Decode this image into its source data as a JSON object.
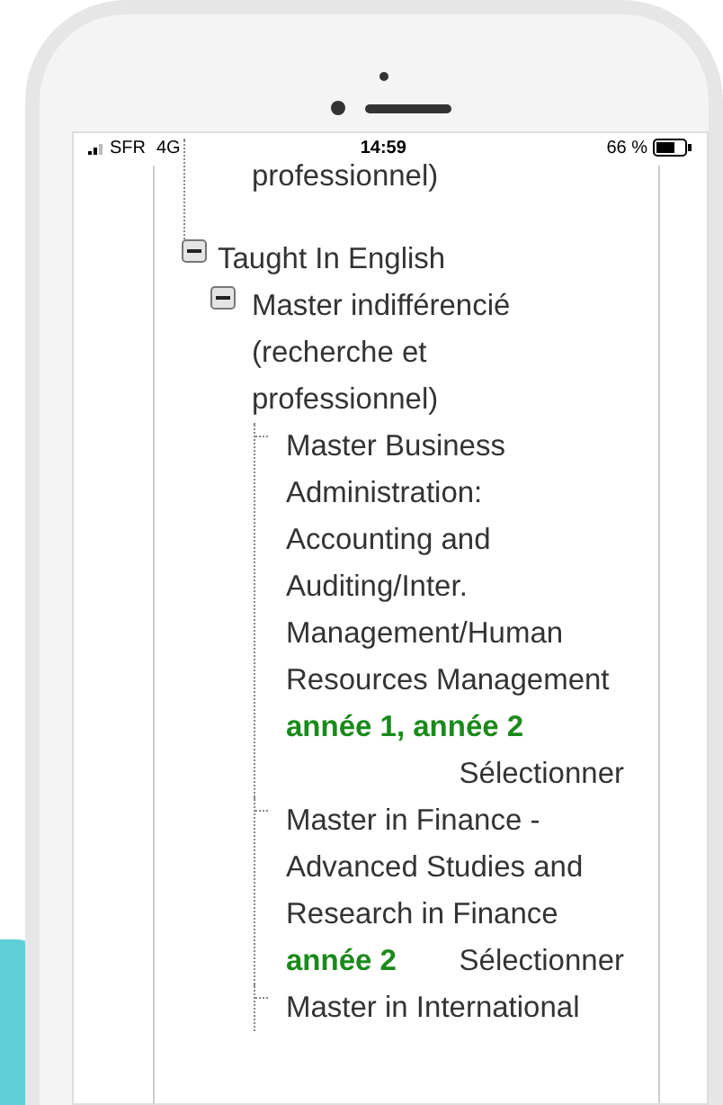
{
  "status_bar": {
    "carrier": "SFR",
    "network": "4G",
    "time": "14:59",
    "battery": "66 %"
  },
  "tree": [
    {
      "label": "professionnel)",
      "kind": "tail"
    },
    {
      "label": "Taught In English",
      "kind": "folder",
      "expanded": true,
      "children": [
        {
          "label": "Master indifférencié (recherche et professionnel)",
          "kind": "folder",
          "expanded": true,
          "children": [
            {
              "label": "Master Business Administration: Accounting and Auditing/Inter. Management/Human Resources Management",
              "kind": "leaf",
              "years": "année 1, année 2",
              "action": "Sélectionner"
            },
            {
              "label": "Master in Finance - Advanced Studies and Research in Finance",
              "kind": "leaf",
              "years": "année 2",
              "action": "Sélectionner"
            },
            {
              "label": "Master in International",
              "kind": "leaf"
            }
          ]
        }
      ]
    }
  ]
}
